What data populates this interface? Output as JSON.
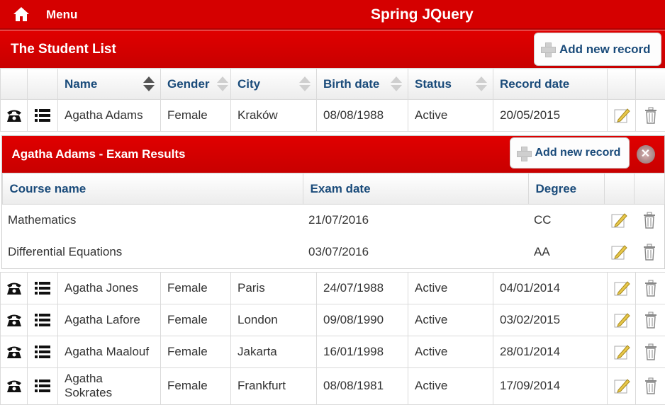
{
  "topbar": {
    "menu_label": "Menu",
    "app_title": "Spring JQuery"
  },
  "panel": {
    "title": "The Student List",
    "add_label": "Add new record"
  },
  "columns": {
    "name": "Name",
    "gender": "Gender",
    "city": "City",
    "birth": "Birth date",
    "status": "Status",
    "record": "Record date"
  },
  "students": [
    {
      "name": "Agatha Adams",
      "gender": "Female",
      "city": "Kraków",
      "birth": "08/08/1988",
      "status": "Active",
      "record": "20/05/2015"
    },
    {
      "name": "Agatha Jones",
      "gender": "Female",
      "city": "Paris",
      "birth": "24/07/1988",
      "status": "Active",
      "record": "04/01/2014"
    },
    {
      "name": "Agatha Lafore",
      "gender": "Female",
      "city": "London",
      "birth": "09/08/1990",
      "status": "Active",
      "record": "03/02/2015"
    },
    {
      "name": "Agatha Maalouf",
      "gender": "Female",
      "city": "Jakarta",
      "birth": "16/01/1998",
      "status": "Active",
      "record": "28/01/2014"
    },
    {
      "name": "Agatha Sokrates",
      "gender": "Female",
      "city": "Frankfurt",
      "birth": "08/08/1981",
      "status": "Active",
      "record": "17/09/2014"
    }
  ],
  "exam": {
    "title": "Agatha Adams - Exam Results",
    "add_label": "Add new record",
    "columns": {
      "course": "Course name",
      "date": "Exam date",
      "degree": "Degree"
    },
    "rows": [
      {
        "course": "Mathematics",
        "date": "21/07/2016",
        "degree": "CC"
      },
      {
        "course": "Differential Equations",
        "date": "03/07/2016",
        "degree": "AA"
      }
    ]
  },
  "icons": {
    "home": "home-icon",
    "phone": "phone-icon",
    "list": "list-icon",
    "edit": "edit-icon",
    "delete": "trash-icon",
    "close": "close-icon",
    "add": "plus-icon"
  },
  "colors": {
    "brand_red": "#d50000",
    "header_text": "#1a4b7a"
  }
}
